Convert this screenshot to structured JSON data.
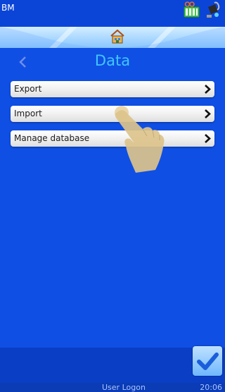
{
  "status_bar": {
    "app_label": "BM",
    "icons": [
      "printer-status-icon",
      "paint-bucket-icon"
    ]
  },
  "header": {
    "title": "Data",
    "home_icon": "home-icon",
    "back_icon": "chevron-left-icon"
  },
  "menu": {
    "items": [
      {
        "label": "Export",
        "icon": "chevron-right-icon"
      },
      {
        "label": "Import",
        "icon": "chevron-right-icon"
      },
      {
        "label": "Manage database",
        "icon": "chevron-right-icon"
      }
    ]
  },
  "overlay": {
    "pointer_icon": "tap-hand-icon"
  },
  "footer": {
    "confirm_icon": "checkmark-icon",
    "user_label": "User Logon",
    "time": "20:06"
  },
  "colors": {
    "background": "#0f4fe4",
    "title": "#41c6ff",
    "band_light": "#a8d8ff",
    "footer_text": "#a9c5ff"
  }
}
